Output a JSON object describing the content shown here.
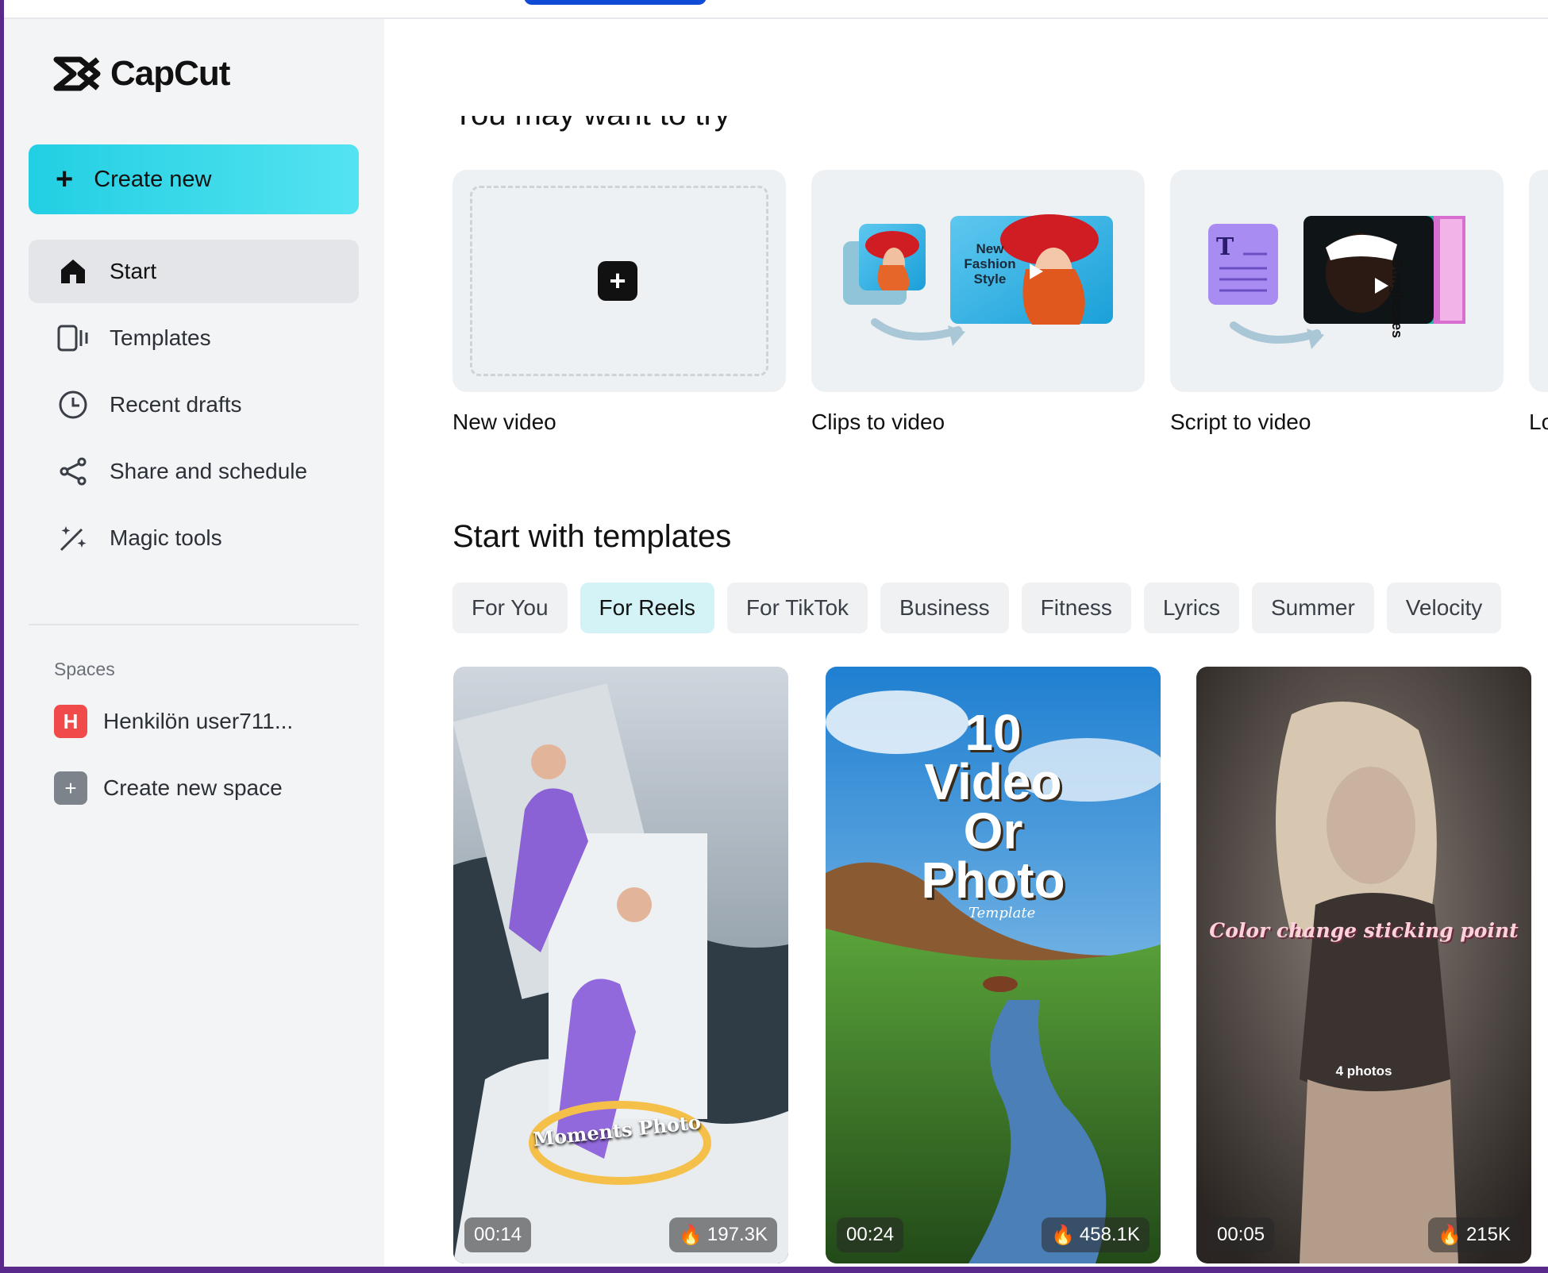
{
  "app": {
    "name": "CapCut"
  },
  "sidebar": {
    "create_new": "Create new",
    "items": [
      {
        "label": "Start",
        "icon": "home-icon",
        "active": true
      },
      {
        "label": "Templates",
        "icon": "templates-icon",
        "active": false
      },
      {
        "label": "Recent drafts",
        "icon": "clock-icon",
        "active": false
      },
      {
        "label": "Share and schedule",
        "icon": "share-icon",
        "active": false
      },
      {
        "label": "Magic tools",
        "icon": "magic-wand-icon",
        "active": false
      }
    ],
    "spaces_label": "Spaces",
    "spaces": [
      {
        "label": "Henkilön user711...",
        "badge": "H",
        "badge_color": "#f04a4a"
      },
      {
        "label": "Create new space",
        "badge": "+",
        "badge_color": "#7d838b"
      }
    ]
  },
  "main": {
    "try_title": "You may want to try",
    "tools": [
      {
        "label": "New video"
      },
      {
        "label": "Clips to video",
        "thumb_text": "New Fashion Style"
      },
      {
        "label": "Script to video",
        "thumb_text": "Sunglasses",
        "doc_glyph": "T"
      },
      {
        "label": "Lo"
      }
    ],
    "templates_title": "Start with templates",
    "chips": [
      {
        "label": "For You",
        "active": false
      },
      {
        "label": "For Reels",
        "active": true
      },
      {
        "label": "For TikTok",
        "active": false
      },
      {
        "label": "Business",
        "active": false
      },
      {
        "label": "Fitness",
        "active": false
      },
      {
        "label": "Lyrics",
        "active": false
      },
      {
        "label": "Summer",
        "active": false
      },
      {
        "label": "Velocity",
        "active": false
      }
    ],
    "templates": [
      {
        "duration": "00:14",
        "uses": "197.3K",
        "overlay": "Moments Photo"
      },
      {
        "duration": "00:24",
        "uses": "458.1K",
        "overlay_lines": [
          "10",
          "Video",
          "Or",
          "Photo"
        ],
        "overlay_script": "Template"
      },
      {
        "duration": "00:05",
        "uses": "215K",
        "overlay": "Color change sticking point",
        "sub": "4 photos"
      }
    ]
  },
  "colors": {
    "accent": "#22cfe3",
    "chip_active": "#d4f3f7",
    "sidebar_bg": "#f3f4f6"
  }
}
